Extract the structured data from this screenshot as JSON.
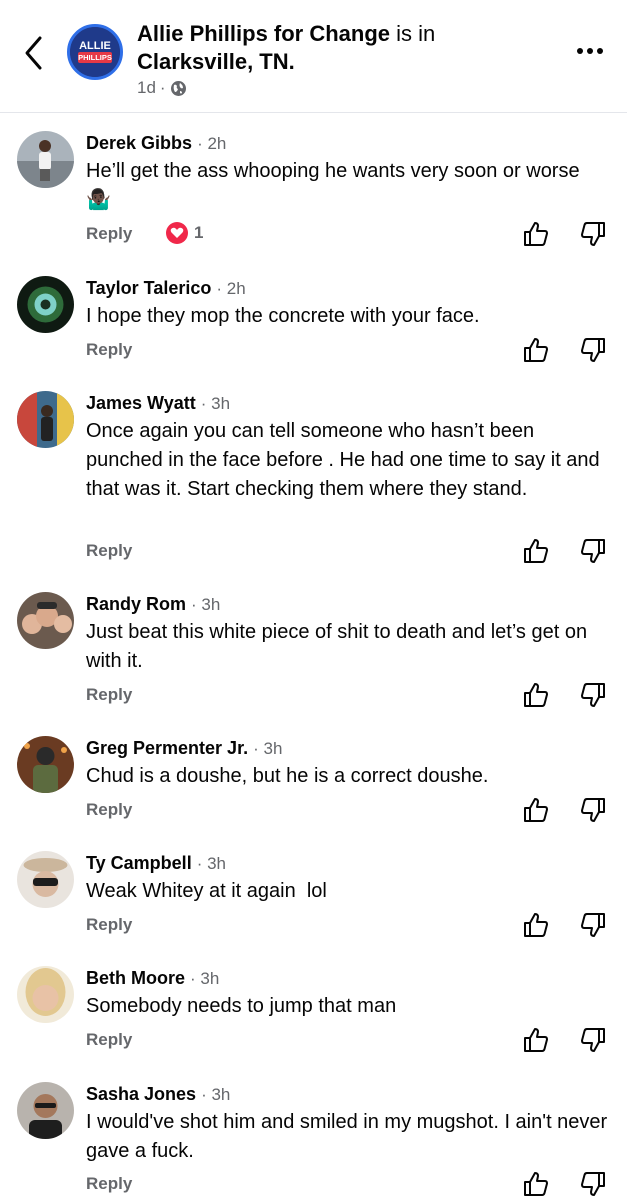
{
  "header": {
    "page_name": "Allie Phillips for Change",
    "connector": " is in ",
    "location": "Clarksville, TN.",
    "avatar_text_top": "ALLIE",
    "avatar_text_bottom": "PHILLIPS",
    "time": "1d",
    "separator": "·",
    "audience_icon": "globe-icon"
  },
  "comments": [
    {
      "author": "Derek Gibbs",
      "time": "· 2h",
      "text": "He’ll get the ass whooping he wants very soon or worse 🤷🏿‍♂️",
      "reply_label": "Reply",
      "reaction_count": "1",
      "avatar_color": "#8a9199"
    },
    {
      "author": "Taylor Talerico",
      "time": "· 2h",
      "text": "I hope they mop the concrete with your face.",
      "reply_label": "Reply",
      "avatar_color": "#1d2a1f"
    },
    {
      "author": "James Wyatt",
      "time": "· 3h",
      "text": "Once again you can tell someone who hasn’t been punched in the face before . He had one time to say it and that was it. Start checking them where they stand.",
      "reply_label": "Reply",
      "avatar_color": "#3e6a8c"
    },
    {
      "author": "Randy Rom",
      "time": "· 3h",
      "text": "Just beat this white piece of shit to death and let’s get on with it.",
      "reply_label": "Reply",
      "avatar_color": "#6b5a4e"
    },
    {
      "author": "Greg Permenter Jr.",
      "time": "· 3h",
      "text": "Chud is a doushe, but he is a correct doushe.",
      "reply_label": "Reply",
      "avatar_color": "#5a4636"
    },
    {
      "author": "Ty Campbell",
      "time": "· 3h",
      "text": "Weak Whitey at it again  lol",
      "reply_label": "Reply",
      "avatar_color": "#c9b7a6"
    },
    {
      "author": "Beth Moore",
      "time": "· 3h",
      "text": "Somebody needs to jump that man",
      "reply_label": "Reply",
      "avatar_color": "#d8c49a"
    },
    {
      "author": "Sasha Jones",
      "time": "· 3h",
      "text": "I would've shot him and smiled in my mugshot. I ain't never gave a fuck.",
      "reply_label": "Reply",
      "avatar_color": "#8f8a85"
    }
  ],
  "colors": {
    "secondary_text": "#65676b",
    "primary_text": "#050505",
    "heart": "#f0284a",
    "page_avatar_bg": "#1f3a8a",
    "page_avatar_ring": "#2f6fe8"
  }
}
